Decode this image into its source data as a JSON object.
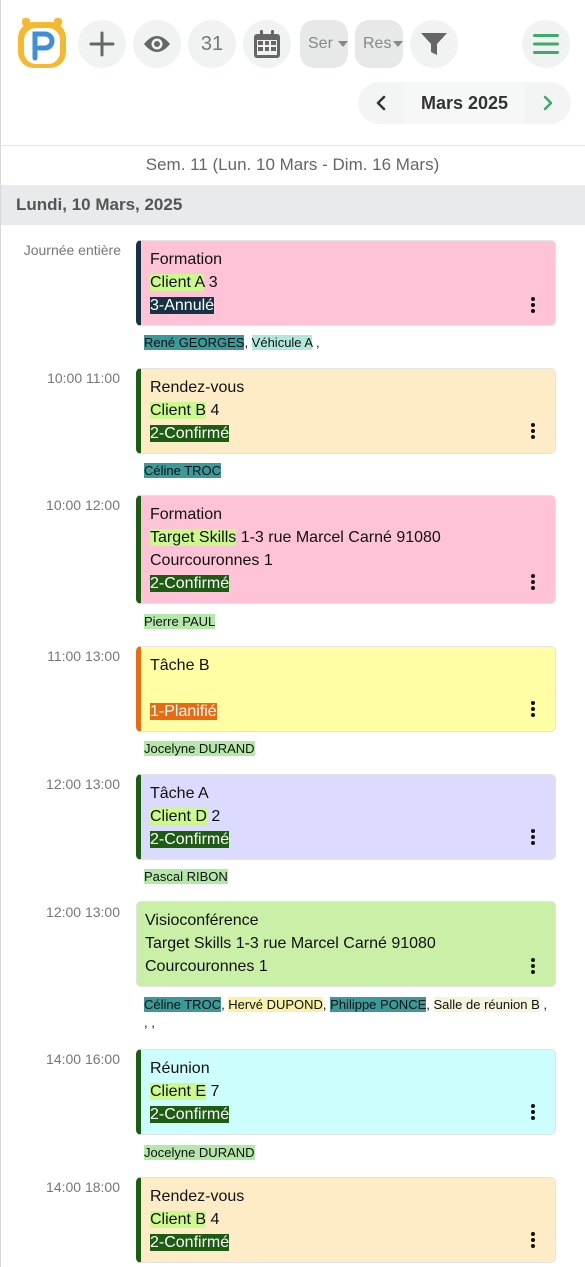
{
  "toolbar": {
    "calendar_day_number": "31",
    "select1_value": "Ser",
    "select2_value": "Res"
  },
  "month_nav": {
    "label": "Mars 2025"
  },
  "week_label": "Sem. 11 (Lun. 10 Mars - Dim. 16 Mars)",
  "day_header": "Lundi, 10 Mars, 2025",
  "colors": {
    "accent_green": "#3dab6a",
    "status_annule": "#163343",
    "status_confirme": "#1c5d12",
    "status_planifie": "#ea6a12"
  },
  "events": [
    {
      "time": "Journée entière",
      "title": "Formation",
      "client": "Client A",
      "client_suffix": " 3",
      "status": "3-Annulé",
      "resources": [
        {
          "name": "René GEORGES",
          "sep": ", "
        },
        {
          "name": "Véhicule A",
          "sep": " ,"
        }
      ]
    },
    {
      "time": "10:00 11:00",
      "title": "Rendez-vous",
      "client": "Client B",
      "client_suffix": " 4",
      "status": "2-Confirmé",
      "resources": [
        {
          "name": "Céline TROC",
          "sep": ""
        }
      ]
    },
    {
      "time": "10:00 12:00",
      "title": "Formation",
      "client": "Target Skills",
      "client_suffix": " 1-3 rue Marcel Carné 91080 Courcouronnes 1",
      "status": "2-Confirmé",
      "resources": [
        {
          "name": "Pierre PAUL",
          "sep": ""
        }
      ]
    },
    {
      "time": "11:00 13:00",
      "title": "Tâche B",
      "status": "1-Planifié",
      "resources": [
        {
          "name": "Jocelyne DURAND",
          "sep": ""
        }
      ]
    },
    {
      "time": "12:00 13:00",
      "title": "Tâche A",
      "client": "Client D",
      "client_suffix": " 2",
      "status": "2-Confirmé",
      "resources": [
        {
          "name": "Pascal RIBON",
          "sep": ""
        }
      ]
    },
    {
      "time": "12:00 13:00",
      "title": "Visioconférence",
      "address": "Target Skills 1-3 rue Marcel Carné 91080 Courcouronnes 1",
      "resources": [
        {
          "name": "Céline TROC",
          "sep": ", "
        },
        {
          "name": "Hervé DUPOND",
          "sep": ", "
        },
        {
          "name": "Philippe PONCE",
          "sep": ", "
        },
        {
          "name": "Salle de réunion B",
          "sep": " , , ,"
        }
      ]
    },
    {
      "time": "14:00 16:00",
      "title": "Réunion",
      "client": "Client E",
      "client_suffix": " 7",
      "status": "2-Confirmé",
      "resources": [
        {
          "name": "Jocelyne DURAND",
          "sep": ""
        }
      ]
    },
    {
      "time": "14:00 18:00",
      "title": "Rendez-vous",
      "client": "Client B",
      "client_suffix": " 4",
      "status": "2-Confirmé"
    }
  ]
}
